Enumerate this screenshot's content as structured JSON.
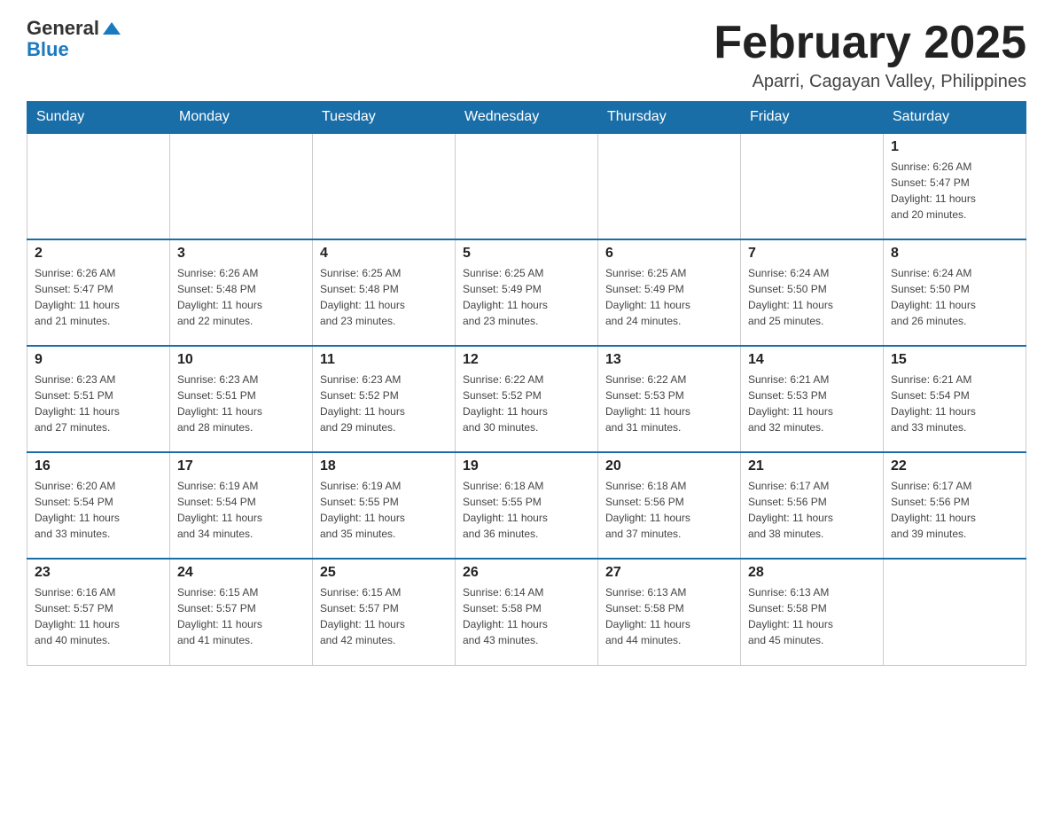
{
  "header": {
    "logo_general": "General",
    "logo_blue": "Blue",
    "month_title": "February 2025",
    "location": "Aparri, Cagayan Valley, Philippines"
  },
  "days_of_week": [
    "Sunday",
    "Monday",
    "Tuesday",
    "Wednesday",
    "Thursday",
    "Friday",
    "Saturday"
  ],
  "weeks": [
    [
      {
        "day": "",
        "info": ""
      },
      {
        "day": "",
        "info": ""
      },
      {
        "day": "",
        "info": ""
      },
      {
        "day": "",
        "info": ""
      },
      {
        "day": "",
        "info": ""
      },
      {
        "day": "",
        "info": ""
      },
      {
        "day": "1",
        "info": "Sunrise: 6:26 AM\nSunset: 5:47 PM\nDaylight: 11 hours\nand 20 minutes."
      }
    ],
    [
      {
        "day": "2",
        "info": "Sunrise: 6:26 AM\nSunset: 5:47 PM\nDaylight: 11 hours\nand 21 minutes."
      },
      {
        "day": "3",
        "info": "Sunrise: 6:26 AM\nSunset: 5:48 PM\nDaylight: 11 hours\nand 22 minutes."
      },
      {
        "day": "4",
        "info": "Sunrise: 6:25 AM\nSunset: 5:48 PM\nDaylight: 11 hours\nand 23 minutes."
      },
      {
        "day": "5",
        "info": "Sunrise: 6:25 AM\nSunset: 5:49 PM\nDaylight: 11 hours\nand 23 minutes."
      },
      {
        "day": "6",
        "info": "Sunrise: 6:25 AM\nSunset: 5:49 PM\nDaylight: 11 hours\nand 24 minutes."
      },
      {
        "day": "7",
        "info": "Sunrise: 6:24 AM\nSunset: 5:50 PM\nDaylight: 11 hours\nand 25 minutes."
      },
      {
        "day": "8",
        "info": "Sunrise: 6:24 AM\nSunset: 5:50 PM\nDaylight: 11 hours\nand 26 minutes."
      }
    ],
    [
      {
        "day": "9",
        "info": "Sunrise: 6:23 AM\nSunset: 5:51 PM\nDaylight: 11 hours\nand 27 minutes."
      },
      {
        "day": "10",
        "info": "Sunrise: 6:23 AM\nSunset: 5:51 PM\nDaylight: 11 hours\nand 28 minutes."
      },
      {
        "day": "11",
        "info": "Sunrise: 6:23 AM\nSunset: 5:52 PM\nDaylight: 11 hours\nand 29 minutes."
      },
      {
        "day": "12",
        "info": "Sunrise: 6:22 AM\nSunset: 5:52 PM\nDaylight: 11 hours\nand 30 minutes."
      },
      {
        "day": "13",
        "info": "Sunrise: 6:22 AM\nSunset: 5:53 PM\nDaylight: 11 hours\nand 31 minutes."
      },
      {
        "day": "14",
        "info": "Sunrise: 6:21 AM\nSunset: 5:53 PM\nDaylight: 11 hours\nand 32 minutes."
      },
      {
        "day": "15",
        "info": "Sunrise: 6:21 AM\nSunset: 5:54 PM\nDaylight: 11 hours\nand 33 minutes."
      }
    ],
    [
      {
        "day": "16",
        "info": "Sunrise: 6:20 AM\nSunset: 5:54 PM\nDaylight: 11 hours\nand 33 minutes."
      },
      {
        "day": "17",
        "info": "Sunrise: 6:19 AM\nSunset: 5:54 PM\nDaylight: 11 hours\nand 34 minutes."
      },
      {
        "day": "18",
        "info": "Sunrise: 6:19 AM\nSunset: 5:55 PM\nDaylight: 11 hours\nand 35 minutes."
      },
      {
        "day": "19",
        "info": "Sunrise: 6:18 AM\nSunset: 5:55 PM\nDaylight: 11 hours\nand 36 minutes."
      },
      {
        "day": "20",
        "info": "Sunrise: 6:18 AM\nSunset: 5:56 PM\nDaylight: 11 hours\nand 37 minutes."
      },
      {
        "day": "21",
        "info": "Sunrise: 6:17 AM\nSunset: 5:56 PM\nDaylight: 11 hours\nand 38 minutes."
      },
      {
        "day": "22",
        "info": "Sunrise: 6:17 AM\nSunset: 5:56 PM\nDaylight: 11 hours\nand 39 minutes."
      }
    ],
    [
      {
        "day": "23",
        "info": "Sunrise: 6:16 AM\nSunset: 5:57 PM\nDaylight: 11 hours\nand 40 minutes."
      },
      {
        "day": "24",
        "info": "Sunrise: 6:15 AM\nSunset: 5:57 PM\nDaylight: 11 hours\nand 41 minutes."
      },
      {
        "day": "25",
        "info": "Sunrise: 6:15 AM\nSunset: 5:57 PM\nDaylight: 11 hours\nand 42 minutes."
      },
      {
        "day": "26",
        "info": "Sunrise: 6:14 AM\nSunset: 5:58 PM\nDaylight: 11 hours\nand 43 minutes."
      },
      {
        "day": "27",
        "info": "Sunrise: 6:13 AM\nSunset: 5:58 PM\nDaylight: 11 hours\nand 44 minutes."
      },
      {
        "day": "28",
        "info": "Sunrise: 6:13 AM\nSunset: 5:58 PM\nDaylight: 11 hours\nand 45 minutes."
      },
      {
        "day": "",
        "info": ""
      }
    ]
  ],
  "accent_color": "#1a6ea8"
}
